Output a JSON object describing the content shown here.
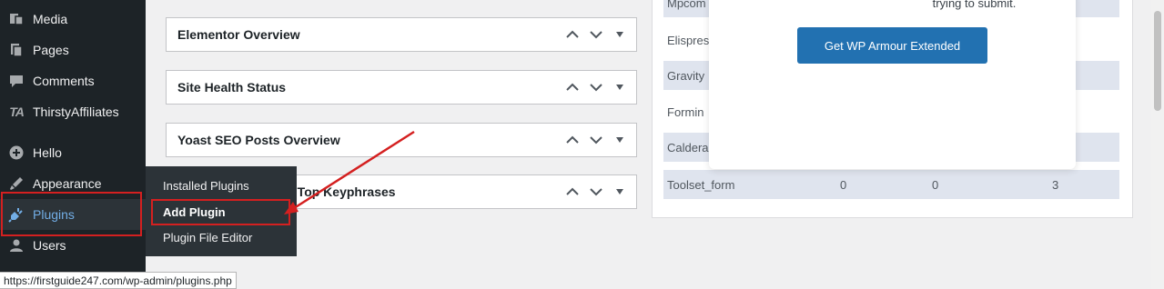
{
  "sidebar": {
    "items": [
      {
        "label": "Media",
        "icon": "media-icon"
      },
      {
        "label": "Pages",
        "icon": "pages-icon"
      },
      {
        "label": "Comments",
        "icon": "comments-icon"
      },
      {
        "label": "ThirstyAffiliates",
        "icon": "thirstyaffiliates-icon",
        "icon_text": "TA"
      },
      {
        "label": "Hello",
        "icon": "hello-icon"
      },
      {
        "label": "Appearance",
        "icon": "appearance-icon"
      },
      {
        "label": "Plugins",
        "icon": "plugins-icon",
        "active": true
      },
      {
        "label": "Users",
        "icon": "users-icon"
      }
    ]
  },
  "flyout": {
    "items": [
      {
        "label": "Installed Plugins"
      },
      {
        "label": "Add Plugin",
        "current": true
      },
      {
        "label": "Plugin File Editor"
      }
    ]
  },
  "widgets": [
    {
      "title": "Elementor Overview"
    },
    {
      "title": "Site Health Status"
    },
    {
      "title": "Yoast SEO Posts Overview"
    },
    {
      "title": "Yoast SEO Top Keyphrases",
      "visible_title": "s Top Keyphrases"
    }
  ],
  "right_panel": {
    "rows": [
      {
        "c1": "Mpcom",
        "c2": "",
        "c3": "",
        "c4": ""
      },
      {
        "c1": "Elispres",
        "c2": "",
        "c3": "",
        "c4": ""
      },
      {
        "c1": "Gravity",
        "c2": "",
        "c3": "",
        "c4": ""
      },
      {
        "c1": "Formin",
        "c2": "",
        "c3": "",
        "c4": ""
      },
      {
        "c1": "Caldera",
        "c2": "",
        "c3": "",
        "c4": ""
      },
      {
        "c1": "Toolset_form",
        "c2": "0",
        "c3": "0",
        "c4": "3"
      }
    ],
    "modal": {
      "text": "trying to submit.",
      "button": "Get WP Armour Extended"
    }
  },
  "status_bar": {
    "url": "https://firstguide247.com/wp-admin/plugins.php"
  },
  "colors": {
    "sidebar_bg": "#1d2327",
    "accent": "#72aee6",
    "button_bg": "#2271b1",
    "highlight_red": "#d42020"
  }
}
